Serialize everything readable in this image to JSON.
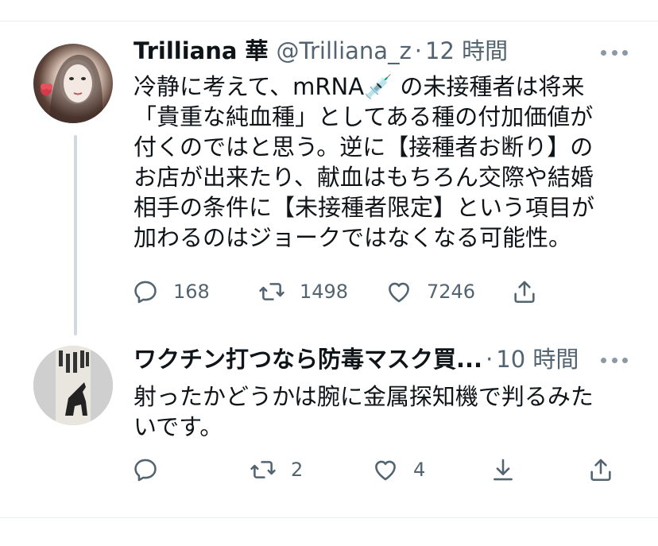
{
  "tweet1": {
    "name": "Trilliana 華",
    "handle": "@Trilliana_z",
    "separator": "·",
    "time": "12 時間",
    "lines": [
      "冷静に考えて、mRNA💉 の未接種者は将来",
      "「貴重な純血種」としてある種の付加価値が",
      "付くのではと思う。逆に【接種者お断り】の",
      "お店が出来たり、献血はもちろん交際や結婚",
      "相手の条件に【未接種者限定】という項目が",
      "加わるのはジョークではなくなる可能性。"
    ],
    "replies": "168",
    "retweets": "1498",
    "likes": "7246",
    "icons": [
      "reply-icon",
      "retweet-icon",
      "like-icon",
      "share-icon"
    ]
  },
  "tweet2": {
    "name": "ワクチン打つなら防毒マスク買...",
    "separator": "·",
    "time": "10 時間",
    "lines": [
      "射ったかどうかは腕に金属探知機で判るみた",
      "いです。"
    ],
    "retweets": "2",
    "likes": "4",
    "icons": [
      "reply-icon",
      "retweet-icon",
      "like-icon",
      "download-icon",
      "share-icon"
    ]
  },
  "colors": {
    "text": "#0f1419",
    "secondary": "#536471",
    "divider": "#e6ecf0",
    "thread_line": "#cfd9de"
  }
}
